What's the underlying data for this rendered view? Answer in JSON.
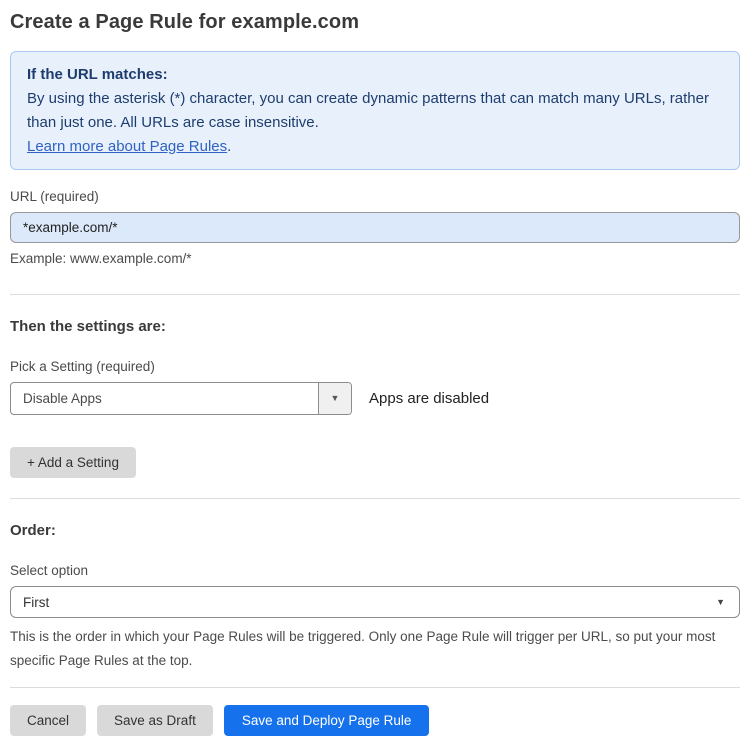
{
  "page": {
    "title": "Create a Page Rule for example.com"
  },
  "info_box": {
    "heading": "If the URL matches:",
    "body": "By using the asterisk (*) character, you can create dynamic patterns that can match many URLs, rather than just one. All URLs are case insensitive.",
    "link": "Learn more about Page Rules",
    "link_suffix": "."
  },
  "url_field": {
    "label": "URL (required)",
    "value": "*example.com/*",
    "helper": "Example: www.example.com/*"
  },
  "settings_section": {
    "heading": "Then the settings are:",
    "setting_label": "Pick a Setting (required)",
    "setting_value": "Disable Apps",
    "setting_status": "Apps are disabled",
    "add_setting_label": "+ Add a Setting"
  },
  "order_section": {
    "heading": "Order:",
    "label": "Select option",
    "value": "First",
    "helper": "This is the order in which your Page Rules will be triggered. Only one Page Rule will trigger per URL, so put your most specific Page Rules at the top."
  },
  "footer": {
    "cancel_label": "Cancel",
    "save_draft_label": "Save as Draft",
    "save_deploy_label": "Save and Deploy Page Rule"
  },
  "icons": {
    "dropdown_arrow": "▼",
    "select_caret": "▼"
  },
  "colors": {
    "info_bg": "#e8f1fb",
    "info_border": "#aac9ee",
    "info_text": "#1e3d6e",
    "link_blue": "#2f62c4",
    "input_bg": "#dbe9fb",
    "primary_button_bg": "#1672ec",
    "gray_button_bg": "#d9d9d9"
  }
}
